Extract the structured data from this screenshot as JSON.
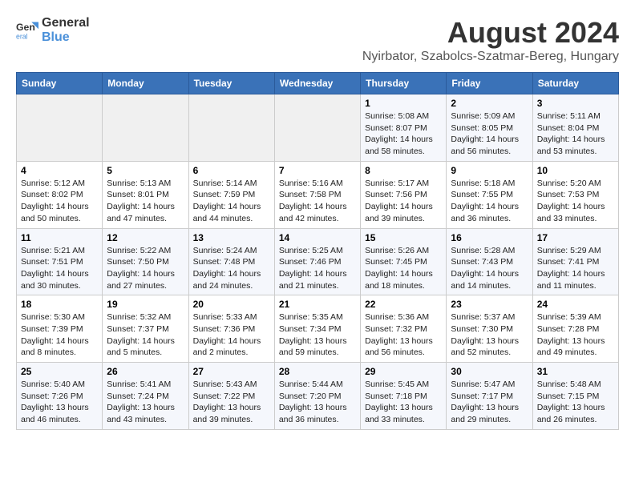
{
  "logo": {
    "line1": "General",
    "line2": "Blue"
  },
  "title": "August 2024",
  "subtitle": "Nyirbator, Szabolcs-Szatmar-Bereg, Hungary",
  "weekdays": [
    "Sunday",
    "Monday",
    "Tuesday",
    "Wednesday",
    "Thursday",
    "Friday",
    "Saturday"
  ],
  "weeks": [
    [
      {
        "day": "",
        "detail": ""
      },
      {
        "day": "",
        "detail": ""
      },
      {
        "day": "",
        "detail": ""
      },
      {
        "day": "",
        "detail": ""
      },
      {
        "day": "1",
        "detail": "Sunrise: 5:08 AM\nSunset: 8:07 PM\nDaylight: 14 hours\nand 58 minutes."
      },
      {
        "day": "2",
        "detail": "Sunrise: 5:09 AM\nSunset: 8:05 PM\nDaylight: 14 hours\nand 56 minutes."
      },
      {
        "day": "3",
        "detail": "Sunrise: 5:11 AM\nSunset: 8:04 PM\nDaylight: 14 hours\nand 53 minutes."
      }
    ],
    [
      {
        "day": "4",
        "detail": "Sunrise: 5:12 AM\nSunset: 8:02 PM\nDaylight: 14 hours\nand 50 minutes."
      },
      {
        "day": "5",
        "detail": "Sunrise: 5:13 AM\nSunset: 8:01 PM\nDaylight: 14 hours\nand 47 minutes."
      },
      {
        "day": "6",
        "detail": "Sunrise: 5:14 AM\nSunset: 7:59 PM\nDaylight: 14 hours\nand 44 minutes."
      },
      {
        "day": "7",
        "detail": "Sunrise: 5:16 AM\nSunset: 7:58 PM\nDaylight: 14 hours\nand 42 minutes."
      },
      {
        "day": "8",
        "detail": "Sunrise: 5:17 AM\nSunset: 7:56 PM\nDaylight: 14 hours\nand 39 minutes."
      },
      {
        "day": "9",
        "detail": "Sunrise: 5:18 AM\nSunset: 7:55 PM\nDaylight: 14 hours\nand 36 minutes."
      },
      {
        "day": "10",
        "detail": "Sunrise: 5:20 AM\nSunset: 7:53 PM\nDaylight: 14 hours\nand 33 minutes."
      }
    ],
    [
      {
        "day": "11",
        "detail": "Sunrise: 5:21 AM\nSunset: 7:51 PM\nDaylight: 14 hours\nand 30 minutes."
      },
      {
        "day": "12",
        "detail": "Sunrise: 5:22 AM\nSunset: 7:50 PM\nDaylight: 14 hours\nand 27 minutes."
      },
      {
        "day": "13",
        "detail": "Sunrise: 5:24 AM\nSunset: 7:48 PM\nDaylight: 14 hours\nand 24 minutes."
      },
      {
        "day": "14",
        "detail": "Sunrise: 5:25 AM\nSunset: 7:46 PM\nDaylight: 14 hours\nand 21 minutes."
      },
      {
        "day": "15",
        "detail": "Sunrise: 5:26 AM\nSunset: 7:45 PM\nDaylight: 14 hours\nand 18 minutes."
      },
      {
        "day": "16",
        "detail": "Sunrise: 5:28 AM\nSunset: 7:43 PM\nDaylight: 14 hours\nand 14 minutes."
      },
      {
        "day": "17",
        "detail": "Sunrise: 5:29 AM\nSunset: 7:41 PM\nDaylight: 14 hours\nand 11 minutes."
      }
    ],
    [
      {
        "day": "18",
        "detail": "Sunrise: 5:30 AM\nSunset: 7:39 PM\nDaylight: 14 hours\nand 8 minutes."
      },
      {
        "day": "19",
        "detail": "Sunrise: 5:32 AM\nSunset: 7:37 PM\nDaylight: 14 hours\nand 5 minutes."
      },
      {
        "day": "20",
        "detail": "Sunrise: 5:33 AM\nSunset: 7:36 PM\nDaylight: 14 hours\nand 2 minutes."
      },
      {
        "day": "21",
        "detail": "Sunrise: 5:35 AM\nSunset: 7:34 PM\nDaylight: 13 hours\nand 59 minutes."
      },
      {
        "day": "22",
        "detail": "Sunrise: 5:36 AM\nSunset: 7:32 PM\nDaylight: 13 hours\nand 56 minutes."
      },
      {
        "day": "23",
        "detail": "Sunrise: 5:37 AM\nSunset: 7:30 PM\nDaylight: 13 hours\nand 52 minutes."
      },
      {
        "day": "24",
        "detail": "Sunrise: 5:39 AM\nSunset: 7:28 PM\nDaylight: 13 hours\nand 49 minutes."
      }
    ],
    [
      {
        "day": "25",
        "detail": "Sunrise: 5:40 AM\nSunset: 7:26 PM\nDaylight: 13 hours\nand 46 minutes."
      },
      {
        "day": "26",
        "detail": "Sunrise: 5:41 AM\nSunset: 7:24 PM\nDaylight: 13 hours\nand 43 minutes."
      },
      {
        "day": "27",
        "detail": "Sunrise: 5:43 AM\nSunset: 7:22 PM\nDaylight: 13 hours\nand 39 minutes."
      },
      {
        "day": "28",
        "detail": "Sunrise: 5:44 AM\nSunset: 7:20 PM\nDaylight: 13 hours\nand 36 minutes."
      },
      {
        "day": "29",
        "detail": "Sunrise: 5:45 AM\nSunset: 7:18 PM\nDaylight: 13 hours\nand 33 minutes."
      },
      {
        "day": "30",
        "detail": "Sunrise: 5:47 AM\nSunset: 7:17 PM\nDaylight: 13 hours\nand 29 minutes."
      },
      {
        "day": "31",
        "detail": "Sunrise: 5:48 AM\nSunset: 7:15 PM\nDaylight: 13 hours\nand 26 minutes."
      }
    ]
  ]
}
